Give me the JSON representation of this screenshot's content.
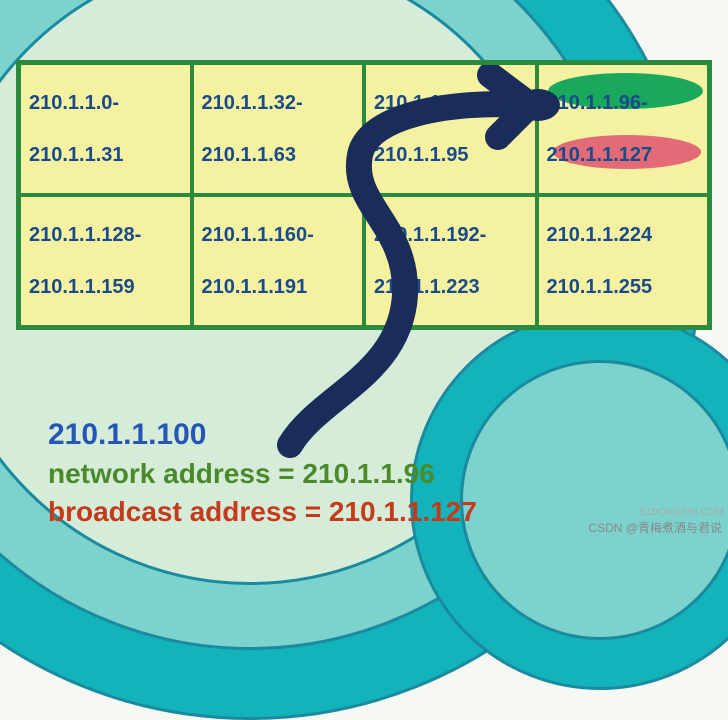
{
  "table": {
    "rows": [
      [
        {
          "start": "210.1.1.0-",
          "end": "210.1.1.31"
        },
        {
          "start": "210.1.1.32-",
          "end": "210.1.1.63"
        },
        {
          "start": "210.1.1.64-",
          "end": "210.1.1.95"
        },
        {
          "start": "210.1.1.96-",
          "end": "210.1.1.127",
          "highlighted": true
        }
      ],
      [
        {
          "start": "210.1.1.128-",
          "end": "210.1.1.159"
        },
        {
          "start": "210.1.1.160-",
          "end": "210.1.1.191"
        },
        {
          "start": "210.1.1.192-",
          "end": "210.1.1.223"
        },
        {
          "start": "210.1.1.224",
          "end": "210.1.1.255"
        }
      ]
    ]
  },
  "labels": {
    "ip": "210.1.1.100",
    "network": "network address = 210.1.1.96",
    "broadcast": "broadcast address = 210.1.1.127"
  },
  "watermark": "CSDN @青梅煮酒与君说",
  "corner": "51DONGSHI.COM"
}
